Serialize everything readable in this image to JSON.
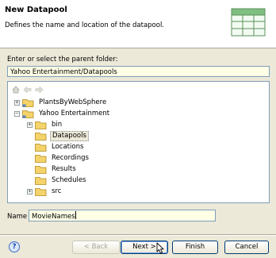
{
  "header": {
    "title": "New Datapool",
    "subtitle": "Defines the name and location of the datapool.",
    "icon": "datapool-table-icon"
  },
  "folder": {
    "prompt": "Enter or select the parent folder:",
    "value": "Yahoo Entertainment/Datapools"
  },
  "tree": {
    "nav_icons": [
      "home-icon",
      "back-arrow-icon",
      "forward-arrow-icon"
    ],
    "nodes": [
      {
        "label": "PlantsByWebSphere",
        "expander": "+",
        "icon": "project-folder-icon"
      },
      {
        "label": "Yahoo Entertainment",
        "expander": "-",
        "icon": "project-folder-icon"
      },
      {
        "label": "bin",
        "expander": "+",
        "icon": "folder-icon"
      },
      {
        "label": "Datapools",
        "expander": "",
        "icon": "folder-icon",
        "selected": true
      },
      {
        "label": "Locations",
        "expander": "",
        "icon": "folder-icon"
      },
      {
        "label": "Recordings",
        "expander": "",
        "icon": "folder-icon"
      },
      {
        "label": "Results",
        "expander": "",
        "icon": "folder-icon"
      },
      {
        "label": "Schedules",
        "expander": "",
        "icon": "folder-icon"
      },
      {
        "label": "src",
        "expander": "+",
        "icon": "folder-icon"
      }
    ]
  },
  "name_field": {
    "label": "Name",
    "value": "MovieNames"
  },
  "buttons": {
    "help": "?",
    "back": "< Back",
    "next": "Next >",
    "finish": "Finish",
    "cancel": "Cancel"
  },
  "colors": {
    "input_bg": "#ffffe6",
    "dialog_bg": "#ece9d8",
    "folder_yellow": "#f4d36b"
  }
}
